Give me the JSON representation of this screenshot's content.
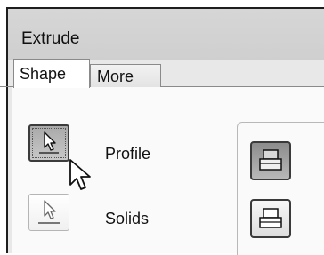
{
  "dialog": {
    "title": "Extrude"
  },
  "tabs": [
    {
      "label": "Shape",
      "active": true
    },
    {
      "label": "More",
      "active": false
    }
  ],
  "input_selectors": {
    "profile": {
      "label": "Profile",
      "icon": "select-arrow-icon",
      "selected": true
    },
    "solids": {
      "label": "Solids",
      "icon": "select-arrow-icon",
      "selected": false
    }
  },
  "output_buttons": [
    {
      "icon": "extrude-solid-icon",
      "pressed": true
    },
    {
      "icon": "extrude-surface-icon",
      "pressed": false
    }
  ],
  "colors": {
    "title_bar": "#d2d2d2",
    "panel": "#fafafa",
    "selected_button": "#b0b0b0"
  }
}
